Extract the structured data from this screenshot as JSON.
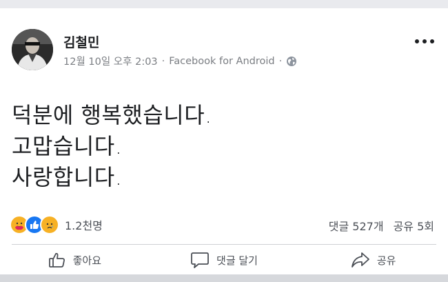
{
  "post": {
    "author": "김철민",
    "timestamp": "12월 10일 오후 2:03",
    "source": "Facebook for Android",
    "separator": "·",
    "privacy_icon": "globe-icon",
    "body_lines": [
      "덕분에 행복했습니다.",
      "고맙습니다.",
      "사랑합니다."
    ]
  },
  "engagement": {
    "reaction_icons": [
      "care-reaction-icon",
      "like-reaction-icon",
      "sad-reaction-icon"
    ],
    "reaction_count": "1.2천명",
    "comments": "댓글 527개",
    "shares": "공유 5회"
  },
  "actions": {
    "like_label": "좋아요",
    "comment_label": "댓글 달기",
    "share_label": "공유"
  },
  "colors": {
    "like_blue": "#1877f2",
    "reaction_yellow": "#f7b125",
    "meta_gray": "#7a7d82"
  }
}
